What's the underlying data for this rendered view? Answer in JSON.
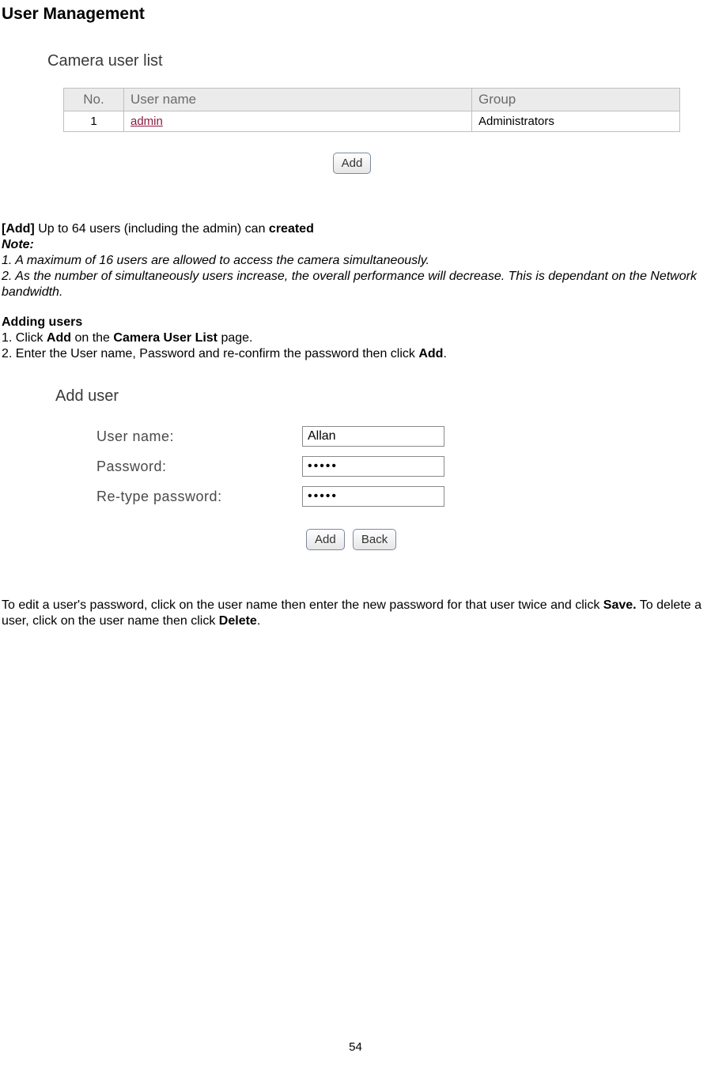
{
  "title": "User Management",
  "shot1": {
    "title": "Camera user list",
    "cols": {
      "no": "No.",
      "user": "User name",
      "group": "Group"
    },
    "rows": [
      {
        "no": "1",
        "user": "admin",
        "group": "Administrators"
      }
    ],
    "add_btn": "Add"
  },
  "body1": {
    "add_label": "[Add]",
    "add_rest": " Up to 64 users (including the admin) can ",
    "add_bold_tail": "created",
    "note_label": "Note:",
    "note1": "1. A maximum of 16 users are allowed to access the camera simultaneously.",
    "note2": "2. As the number of simultaneously users increase, the overall performance will decrease. This is dependant on the Network bandwidth.",
    "adding_label": "Adding users",
    "step1_a": "1. Click ",
    "step1_b": "Add",
    "step1_c": " on the ",
    "step1_d": "Camera User List",
    "step1_e": " page.",
    "step2_a": "2. Enter the User name, Password and re-confirm the password then click ",
    "step2_b": "Add",
    "step2_c": "."
  },
  "shot2": {
    "title": "Add user",
    "labels": {
      "user": "User name:",
      "pass": "Password:",
      "repass": "Re-type password:"
    },
    "values": {
      "user": "Allan",
      "pass": "•••••",
      "repass": "•••••"
    },
    "buttons": {
      "add": "Add",
      "back": "Back"
    }
  },
  "editpara": {
    "a": "To edit a user's password, click on the user name then enter the new password for that user twice and click ",
    "b": "Save.",
    "c": " To delete a user, click on the user name then click ",
    "d": "Delete",
    "e": "."
  },
  "page_number": "54"
}
